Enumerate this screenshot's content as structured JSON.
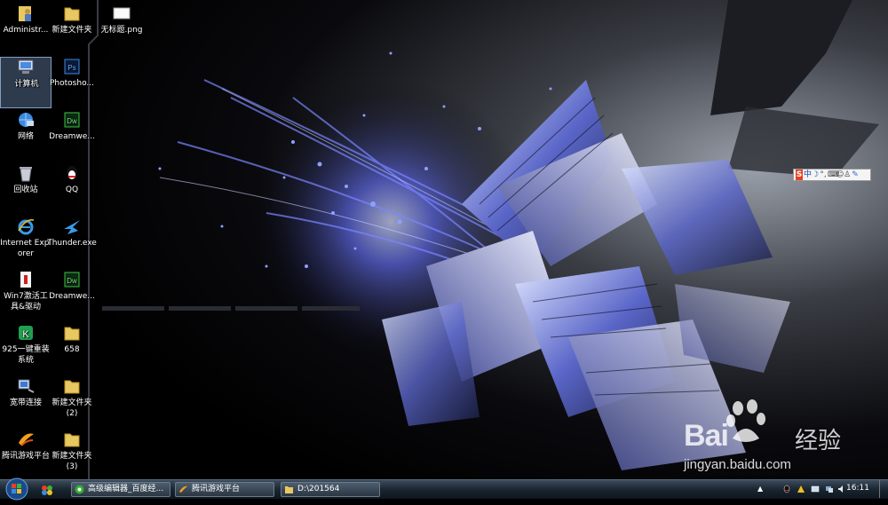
{
  "desktop": {
    "icons": [
      {
        "label": "Administr...",
        "icon": "user-folder-icon"
      },
      {
        "label": "新建文件夹",
        "icon": "folder-icon"
      },
      {
        "label": "无标题.png",
        "icon": "image-file-icon"
      },
      {
        "label": "计算机",
        "icon": "computer-icon"
      },
      {
        "label": "Photosho...",
        "icon": "photoshop-icon"
      },
      {
        "label": "网络",
        "icon": "network-icon"
      },
      {
        "label": "Dreamwe...",
        "icon": "dreamweaver-icon"
      },
      {
        "label": "回收站",
        "icon": "recycle-bin-icon"
      },
      {
        "label": "QQ",
        "icon": "qq-icon"
      },
      {
        "label": "Internet Explorer",
        "icon": "ie-icon"
      },
      {
        "label": "Thunder.exe",
        "icon": "thunder-icon"
      },
      {
        "label": "Win7激活工具&驱动",
        "icon": "activation-tool-icon"
      },
      {
        "label": "Dreamwe...",
        "icon": "dreamweaver-icon"
      },
      {
        "label": "925一键重装系统",
        "icon": "reinstall-icon"
      },
      {
        "label": "658",
        "icon": "folder-icon"
      },
      {
        "label": "宽带连接",
        "icon": "broadband-icon"
      },
      {
        "label": "新建文件夹 (2)",
        "icon": "folder-icon"
      },
      {
        "label": "腾讯游戏平台",
        "icon": "tencent-games-icon"
      },
      {
        "label": "新建文件夹 (3)",
        "icon": "folder-icon"
      }
    ]
  },
  "ime_bar": {
    "logo": "S",
    "mode": "中"
  },
  "watermark": {
    "brand": "Bai",
    "brand_cn": "经验",
    "url": "jingyan.baidu.com"
  },
  "taskbar": {
    "tasks": [
      {
        "label": "高级编辑器_百度经...",
        "icon": "browser-icon"
      },
      {
        "label": "腾讯游戏平台",
        "icon": "tencent-games-icon"
      },
      {
        "label": "D:\\201564",
        "icon": "folder-icon"
      }
    ],
    "clock": "16:11"
  },
  "colors": {
    "accent": "#3a6fd8",
    "taskbar": "#1a2530"
  }
}
